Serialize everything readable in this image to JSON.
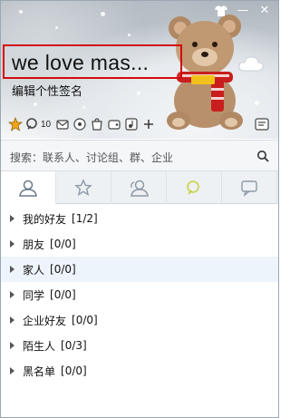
{
  "profile": {
    "nickname": "we love mas...",
    "signature": "编辑个性签名"
  },
  "titlebar": {
    "skin_icon": "shirt-icon",
    "minimize_label": "—",
    "close_label": "✕"
  },
  "iconbar": {
    "icons": [
      "qzone-star-icon",
      "microblog-icon",
      "mail-icon",
      "game-icon",
      "shopping-icon",
      "wallet-icon",
      "music-icon",
      "app-add-icon"
    ],
    "unread_count": "10"
  },
  "search": {
    "placeholder": "搜索：联系人、讨论组、群、企业"
  },
  "tabs": [
    {
      "name": "contacts",
      "icon": "person-icon"
    },
    {
      "name": "favorites",
      "icon": "star-icon"
    },
    {
      "name": "groups",
      "icon": "group-icon"
    },
    {
      "name": "microblog",
      "icon": "microblog-icon"
    },
    {
      "name": "recent",
      "icon": "chat-icon"
    }
  ],
  "groups": [
    {
      "name": "我的好友",
      "count": "[1/2]"
    },
    {
      "name": "朋友",
      "count": "[0/0]"
    },
    {
      "name": "家人",
      "count": "[0/0]"
    },
    {
      "name": "同学",
      "count": "[0/0]"
    },
    {
      "name": "企业好友",
      "count": "[0/0]"
    },
    {
      "name": "陌生人",
      "count": "[0/3]"
    },
    {
      "name": "黑名单",
      "count": "[0/0]"
    }
  ],
  "colors": {
    "highlight_border": "#d40b0b",
    "accent": "#f1a51c"
  }
}
